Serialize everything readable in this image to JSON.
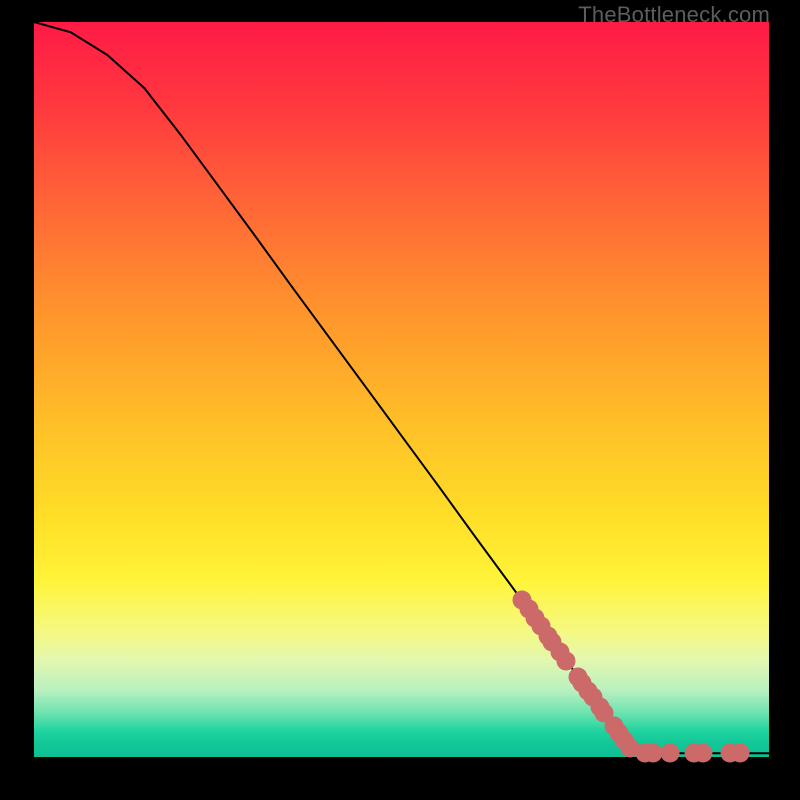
{
  "attribution": "TheBottleneck.com",
  "chart_data": {
    "type": "line",
    "title": "",
    "xlabel": "",
    "ylabel": "",
    "x_range": [
      0,
      100
    ],
    "y_range": [
      0,
      100
    ],
    "grid": false,
    "legend": false,
    "curve": [
      {
        "x": 0,
        "y": 100
      },
      {
        "x": 5,
        "y": 98.6
      },
      {
        "x": 10,
        "y": 95.5
      },
      {
        "x": 15,
        "y": 91.0
      },
      {
        "x": 20,
        "y": 84.6
      },
      {
        "x": 25,
        "y": 77.8
      },
      {
        "x": 30,
        "y": 71.0
      },
      {
        "x": 35,
        "y": 64.1
      },
      {
        "x": 40,
        "y": 57.3
      },
      {
        "x": 45,
        "y": 50.5
      },
      {
        "x": 50,
        "y": 43.7
      },
      {
        "x": 55,
        "y": 36.9
      },
      {
        "x": 60,
        "y": 30.0
      },
      {
        "x": 65,
        "y": 23.2
      },
      {
        "x": 70,
        "y": 16.4
      },
      {
        "x": 75,
        "y": 9.6
      },
      {
        "x": 80,
        "y": 2.7
      },
      {
        "x": 82,
        "y": 0.6
      },
      {
        "x": 84,
        "y": 0.5
      },
      {
        "x": 88,
        "y": 0.5
      },
      {
        "x": 92,
        "y": 0.5
      },
      {
        "x": 96,
        "y": 0.5
      },
      {
        "x": 100,
        "y": 0.5
      }
    ],
    "markers": [
      {
        "x": 66.4,
        "y": 21.3
      },
      {
        "x": 67.3,
        "y": 20.1
      },
      {
        "x": 68.2,
        "y": 18.9
      },
      {
        "x": 69.0,
        "y": 17.8
      },
      {
        "x": 69.9,
        "y": 16.5
      },
      {
        "x": 70.5,
        "y": 15.7
      },
      {
        "x": 71.5,
        "y": 14.3
      },
      {
        "x": 72.4,
        "y": 13.1
      },
      {
        "x": 74.0,
        "y": 10.9
      },
      {
        "x": 74.6,
        "y": 10.1
      },
      {
        "x": 75.4,
        "y": 9.0
      },
      {
        "x": 76.1,
        "y": 8.1
      },
      {
        "x": 77.0,
        "y": 6.8
      },
      {
        "x": 77.6,
        "y": 6.0
      },
      {
        "x": 78.9,
        "y": 4.2
      },
      {
        "x": 79.6,
        "y": 3.3
      },
      {
        "x": 80.3,
        "y": 2.3
      },
      {
        "x": 81.1,
        "y": 1.2
      },
      {
        "x": 83.1,
        "y": 0.6
      },
      {
        "x": 84.2,
        "y": 0.6
      },
      {
        "x": 86.5,
        "y": 0.6
      },
      {
        "x": 89.8,
        "y": 0.6
      },
      {
        "x": 91.0,
        "y": 0.6
      },
      {
        "x": 94.7,
        "y": 0.6
      },
      {
        "x": 96.1,
        "y": 0.6
      }
    ],
    "marker_color": "#cc6a6a"
  }
}
